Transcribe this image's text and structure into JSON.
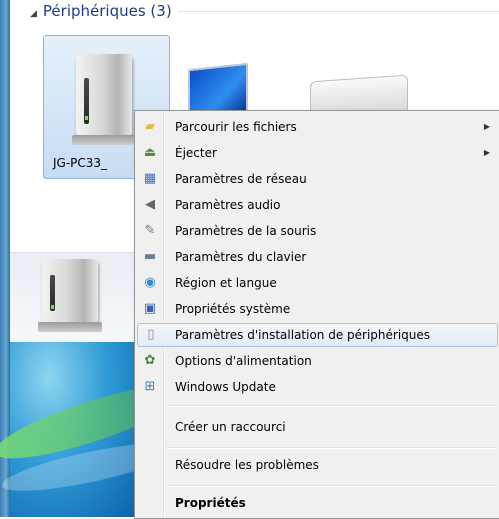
{
  "group": {
    "title": "Périphériques (3)"
  },
  "device": {
    "label": "JG-PC33_"
  },
  "menu": {
    "items": [
      {
        "label": "Parcourir les fichiers",
        "icon": "folder-icon",
        "submenu": true
      },
      {
        "label": "Éjecter",
        "icon": "eject-icon",
        "submenu": true
      },
      {
        "label": "Paramètres de réseau",
        "icon": "network-icon",
        "submenu": false
      },
      {
        "label": "Paramètres audio",
        "icon": "speaker-icon",
        "submenu": false
      },
      {
        "label": "Paramètres de la souris",
        "icon": "mouse-icon",
        "submenu": false
      },
      {
        "label": "Paramètres du clavier",
        "icon": "keyboard-icon",
        "submenu": false
      },
      {
        "label": "Région et langue",
        "icon": "globe-icon",
        "submenu": false
      },
      {
        "label": "Propriétés système",
        "icon": "system-icon",
        "submenu": false
      },
      {
        "label": "Paramètres d'installation de périphériques",
        "icon": "device-install-icon",
        "submenu": false
      },
      {
        "label": "Options d'alimentation",
        "icon": "power-options-icon",
        "submenu": false
      },
      {
        "label": "Windows Update",
        "icon": "windows-update-icon",
        "submenu": false
      },
      {
        "label": "Créer un raccourci",
        "icon": "",
        "submenu": false
      },
      {
        "label": "Résoudre les problèmes",
        "icon": "",
        "submenu": false
      },
      {
        "label": "Propriétés",
        "icon": "",
        "submenu": false
      }
    ],
    "hovered": "Paramètres d'installation de périphériques"
  },
  "colors": {
    "accent": "#1e3b8a",
    "selection_border": "#a8c4e6",
    "menu_background": "#f0f0f0"
  }
}
